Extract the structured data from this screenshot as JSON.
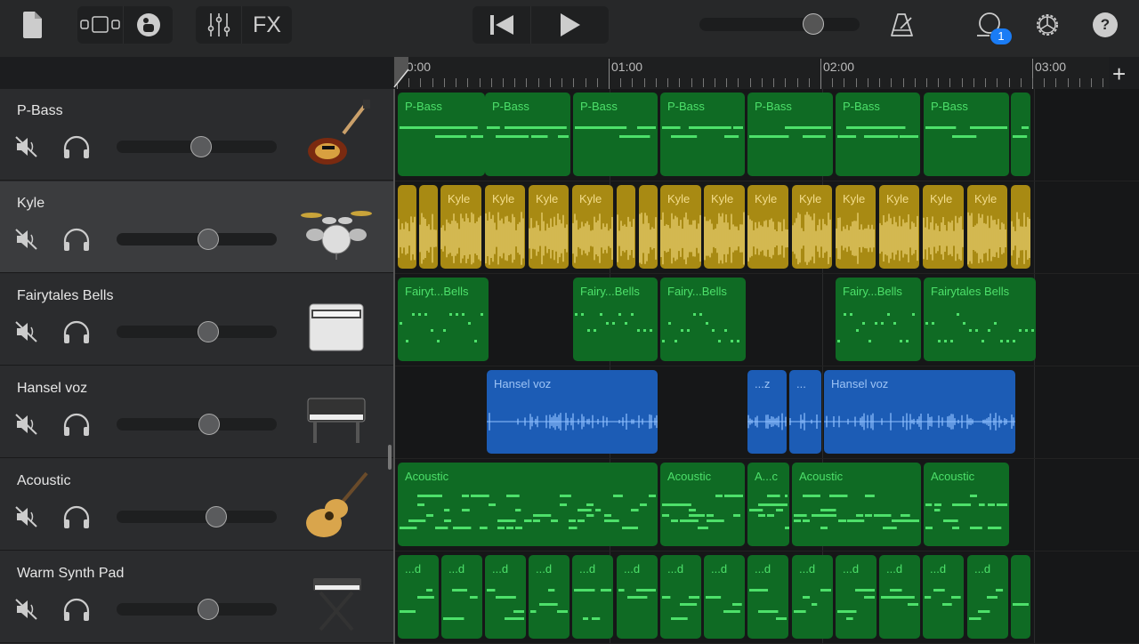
{
  "toolbar": {
    "fx_label": "FX",
    "notification_count": "1",
    "master_volume": 0.71,
    "icons": [
      "document-icon",
      "track-view-icon",
      "drummer-icon",
      "mixer-icon",
      "skip-back-icon",
      "play-icon",
      "metronome-icon",
      "loop-browser-icon",
      "settings-icon",
      "help-icon"
    ]
  },
  "ruler": {
    "labels": [
      "00:00",
      "01:00",
      "02:00",
      "03:00"
    ],
    "add_label": "+"
  },
  "colors": {
    "midi": "#0f6b24",
    "midi_notes": "#4de06a",
    "audio": "#a88a13",
    "audio_voice": "#1c5cb5",
    "badge": "#1a7cf5"
  },
  "tracks": [
    {
      "name": "P-Bass",
      "volume": 0.53,
      "instrument": "bass-guitar",
      "kind": "midi",
      "regions": [
        "P-Bass",
        "P-Bass",
        "P-Bass",
        "P-Bass",
        "P-Bass",
        "P-Bass",
        "P-Bass",
        ""
      ]
    },
    {
      "name": "Kyle",
      "volume": 0.57,
      "instrument": "drum-kit",
      "kind": "audio",
      "selected": true,
      "regions": [
        "",
        "",
        "Kyle",
        "Kyle",
        "Kyle",
        "Kyle",
        "",
        "",
        "Kyle",
        "Kyle",
        "Kyle",
        "Kyle",
        "Kyle",
        "Kyle",
        "Kyle",
        "Kyle",
        ""
      ]
    },
    {
      "name": "Fairytales Bells",
      "volume": 0.57,
      "instrument": "organ",
      "kind": "midi",
      "regions": [
        "Fairyt...Bells",
        "Fairy...Bells",
        "Fairy...Bells",
        "Fairy...Bells",
        "Fairytales Bells"
      ]
    },
    {
      "name": "Hansel voz",
      "volume": 0.58,
      "instrument": "electric-piano",
      "kind": "blue",
      "regions": [
        "Hansel voz",
        "...z",
        "...",
        "Hansel voz"
      ]
    },
    {
      "name": "Acoustic",
      "volume": 0.62,
      "instrument": "acoustic-guitar",
      "kind": "midi",
      "regions": [
        "Acoustic",
        "Acoustic",
        "A...c",
        "Acoustic",
        "Acoustic"
      ]
    },
    {
      "name": "Warm Synth Pad",
      "volume": 0.57,
      "instrument": "synth-keyboard",
      "kind": "midi",
      "regions": [
        "...d",
        "...d",
        "...d",
        "...d",
        "...d",
        "...d",
        "...d",
        "...d",
        "...d",
        "...d",
        "...d",
        "...d",
        "...d",
        "...d",
        ""
      ]
    }
  ]
}
